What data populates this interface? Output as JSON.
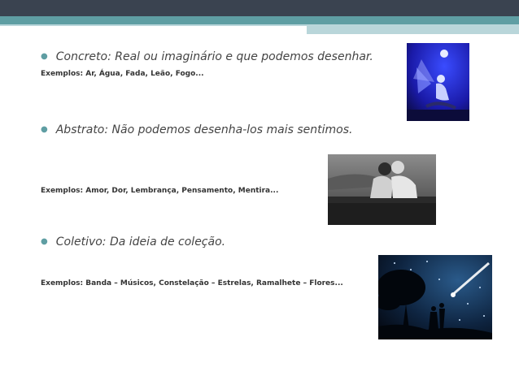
{
  "items": [
    {
      "heading": "Concreto: Real ou imaginário e que podemos desenhar.",
      "examples": "Exemplos: Ar, Água, Fada, Leão, Fogo...",
      "image_icon": "fairy-illustration"
    },
    {
      "heading": "Abstrato: Não podemos desenha-los mais sentimos.",
      "examples": "Exemplos: Amor, Dor, Lembrança, Pensamento, Mentira...",
      "image_icon": "couple-photo"
    },
    {
      "heading": "Coletivo: Da ideia de coleção.",
      "examples": "Exemplos: Banda – Músicos, Constelação – Estrelas, Ramalhete – Flores...",
      "image_icon": "starry-night-photo"
    }
  ],
  "colors": {
    "accent": "#5f9ea3",
    "dark_band": "#3a4350",
    "light_band": "#b9d6da",
    "text": "#444444"
  }
}
